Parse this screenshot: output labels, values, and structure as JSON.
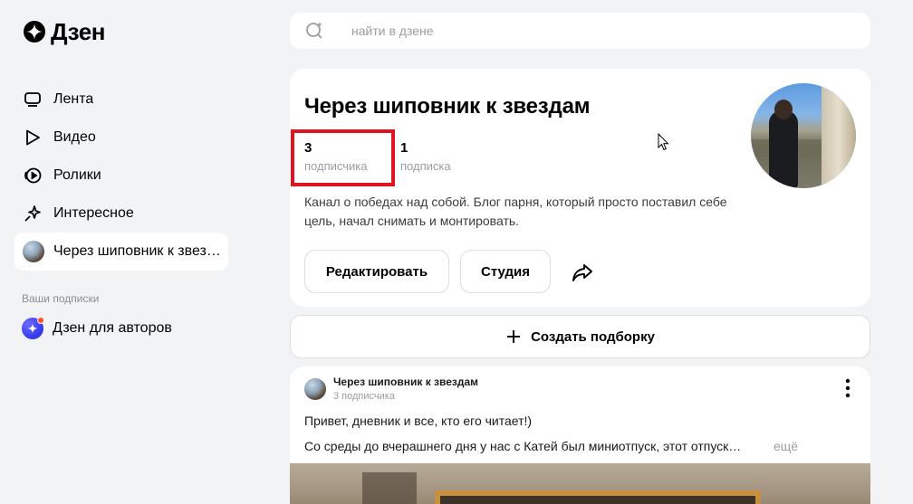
{
  "logo": {
    "text": "Дзен"
  },
  "nav": {
    "items": [
      {
        "label": "Лента",
        "icon": "feed-icon"
      },
      {
        "label": "Видео",
        "icon": "play-icon"
      },
      {
        "label": "Ролики",
        "icon": "clips-icon"
      },
      {
        "label": "Интересное",
        "icon": "sparkle-icon"
      },
      {
        "label": "Через шиповник к звез…",
        "icon": "channel-avatar",
        "active": true
      }
    ],
    "subscriptions_title": "Ваши подписки",
    "subscriptions": [
      {
        "label": "Дзен для авторов",
        "icon": "dzen-authors-icon"
      }
    ]
  },
  "search": {
    "placeholder": "найти в дзене",
    "value": ""
  },
  "channel": {
    "title": "Через шиповник к звездам",
    "followers_count": "3",
    "followers_label": "подписчика",
    "following_count": "1",
    "following_label": "подписка",
    "description": "Канал о победах над собой. Блог парня, который просто поставил себе цель, начал снимать и монтировать.",
    "edit_button": "Редактировать",
    "studio_button": "Студия"
  },
  "create_collection": {
    "label": "Создать подборку"
  },
  "post": {
    "author": "Через шиповник к звездам",
    "subs": "3 подписчика",
    "line1": "Привет, дневник и все, кто его читает!)",
    "line2": "Со среды до вчерашнего дня у нас с Катей был миниотпуск, этот отпуск…",
    "more": "ещё"
  },
  "colors": {
    "background": "#f2f3f5",
    "card": "#ffffff",
    "highlight": "#e0141e",
    "muted_text": "#9a9ca1"
  }
}
